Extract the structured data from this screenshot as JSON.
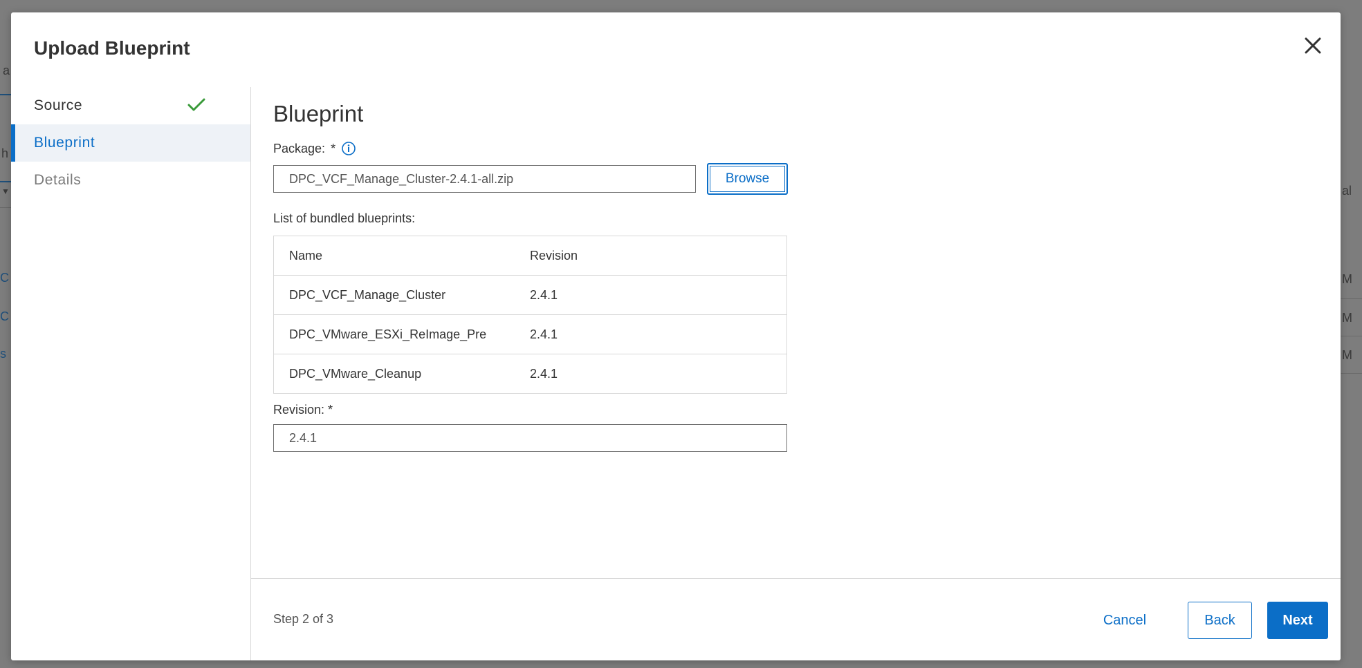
{
  "background": {
    "fragments": [
      "a",
      "h",
      "al",
      "C",
      "C",
      "s",
      "M",
      "M",
      "M"
    ]
  },
  "modal": {
    "title": "Upload Blueprint",
    "close_icon": "close-icon"
  },
  "wizard": {
    "steps": [
      {
        "label": "Source",
        "state": "completed",
        "icon": "check-icon"
      },
      {
        "label": "Blueprint",
        "state": "active"
      },
      {
        "label": "Details",
        "state": "disabled"
      }
    ]
  },
  "form": {
    "section_title": "Blueprint",
    "package_label": "Package:",
    "required_marker": "*",
    "info_icon": "info-icon",
    "package_value": "DPC_VCF_Manage_Cluster-2.4.1-all.zip",
    "browse_label": "Browse",
    "list_label": "List of bundled blueprints:",
    "table": {
      "headers": [
        "Name",
        "Revision"
      ],
      "rows": [
        {
          "name": "DPC_VCF_Manage_Cluster",
          "revision": "2.4.1"
        },
        {
          "name": "DPC_VMware_ESXi_ReImage_Pre",
          "revision": "2.4.1"
        },
        {
          "name": "DPC_VMware_Cleanup",
          "revision": "2.4.1"
        }
      ]
    },
    "revision_label": "Revision: *",
    "revision_value": "2.4.1"
  },
  "footer": {
    "step_text": "Step 2 of 3",
    "cancel_label": "Cancel",
    "back_label": "Back",
    "next_label": "Next"
  },
  "colors": {
    "accent": "#0b6ec7",
    "success": "#3a9a3a",
    "overlay": "#7d7d7d"
  }
}
